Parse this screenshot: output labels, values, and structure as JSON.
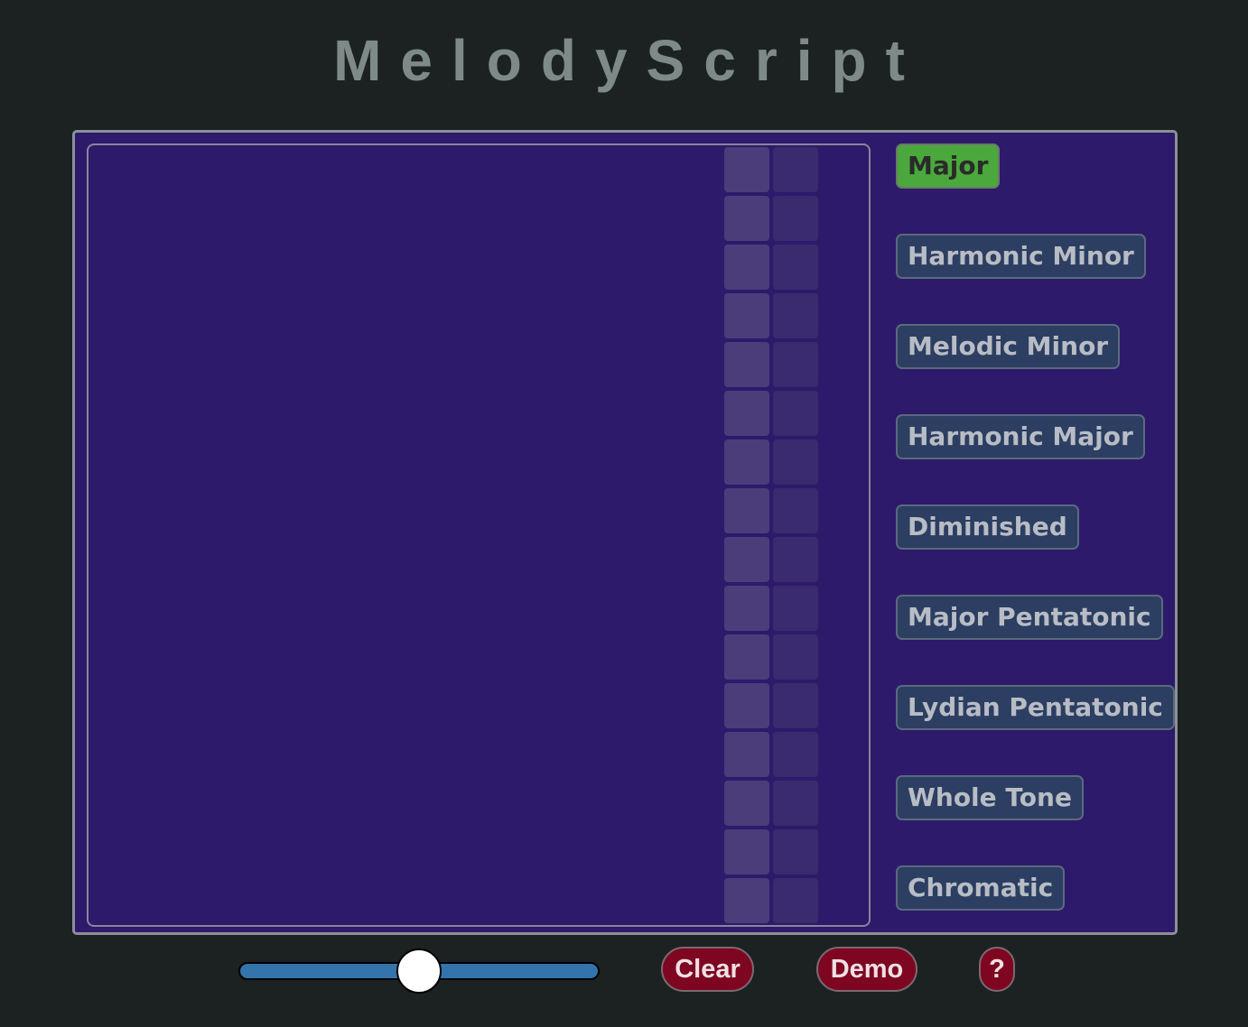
{
  "title": "MelodyScript",
  "grid": {
    "rows": 16,
    "columns": 2
  },
  "scales": [
    {
      "label": "Major",
      "active": true
    },
    {
      "label": "Harmonic Minor",
      "active": false
    },
    {
      "label": "Melodic Minor",
      "active": false
    },
    {
      "label": "Harmonic Major",
      "active": false
    },
    {
      "label": "Diminished",
      "active": false
    },
    {
      "label": "Major Pentatonic",
      "active": false
    },
    {
      "label": "Lydian Pentatonic",
      "active": false
    },
    {
      "label": "Whole Tone",
      "active": false
    },
    {
      "label": "Chromatic",
      "active": false
    }
  ],
  "controls": {
    "slider_value": 0.5,
    "clear_label": "Clear",
    "demo_label": "Demo",
    "help_label": "?"
  },
  "colors": {
    "active": "#4aa83c",
    "panel": "#2d1a6b",
    "button_red": "#7e0620"
  }
}
